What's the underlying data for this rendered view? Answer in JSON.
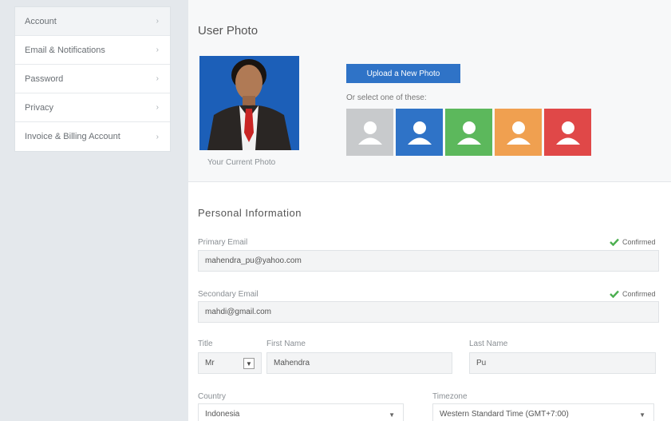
{
  "sidebar": {
    "items": [
      {
        "label": "Account"
      },
      {
        "label": "Email & Notifications"
      },
      {
        "label": "Password"
      },
      {
        "label": "Privacy"
      },
      {
        "label": "Invoice & Billing Account"
      }
    ]
  },
  "photo": {
    "title": "User Photo",
    "caption": "Your Current Photo",
    "upload_label": "Upload a New Photo",
    "default_label": "Or select one of these:",
    "avatar_colors": [
      "#c8cacc",
      "#2f73c7",
      "#5cb85c",
      "#f0a050",
      "#e04848"
    ]
  },
  "personal": {
    "title": "Personal Information",
    "primary_email_label": "Primary Email",
    "primary_email_value": "mahendra_pu@yahoo.com",
    "primary_status": "Confirmed",
    "secondary_email_label": "Secondary Email",
    "secondary_email_value": "mahdi@gmail.com",
    "secondary_status": "Confirmed",
    "title_label": "Title",
    "title_value": "Mr",
    "first_name_label": "First Name",
    "first_name_value": "Mahendra",
    "last_name_label": "Last Name",
    "last_name_value": "Pu",
    "country_label": "Country",
    "country_value": "Indonesia",
    "timezone_label": "Timezone",
    "timezone_value": "Western Standard Time (GMT+7:00)"
  },
  "colors": {
    "accent": "#2f73c7",
    "confirmed": "#4caf50"
  }
}
